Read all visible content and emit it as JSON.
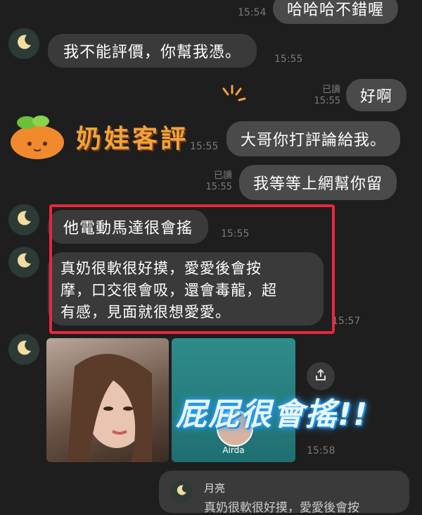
{
  "messages": {
    "m0": {
      "text": "哈哈哈不錯喔",
      "time": "15:54"
    },
    "m1": {
      "text": "我不能評價，你幫我憑。",
      "time": "15:55"
    },
    "m2": {
      "text": "好啊",
      "read": "已讀",
      "time": "15:55"
    },
    "m3": {
      "text": "大哥你打評論給我。",
      "time": "15:55"
    },
    "m4": {
      "text": "我等等上網幫你留",
      "read": "已讀",
      "time": "15:55"
    },
    "m5": {
      "text": "他電動馬達很會搖",
      "time": "15:55"
    },
    "m6": {
      "line1": "真奶很軟很好摸，愛愛後會按",
      "line2": "摩，口交很會吸，還會毒龍，超",
      "line3": "有感，見面就很想愛愛。",
      "time": "15:57"
    },
    "m7": {
      "time": "15:58",
      "profile_name": "Airda"
    }
  },
  "watermark": {
    "brand": "奶娃客評",
    "caption": "屁屁很會搖!!"
  },
  "reply_preview": {
    "sender": "月亮",
    "snippet": "真奶很軟很好摸，愛愛後會按"
  },
  "icons": {
    "avatar": "crescent-moon-icon",
    "share": "share-icon",
    "logo": "persimmon-icon"
  },
  "colors": {
    "highlight": "#e8283c",
    "background": "#1e1e1e",
    "bubble": "#3a3a3a"
  }
}
